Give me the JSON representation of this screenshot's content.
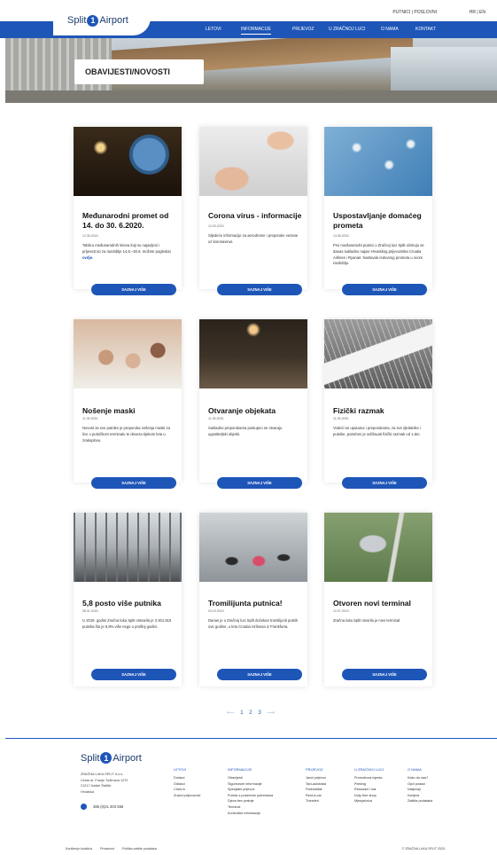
{
  "brand": {
    "name_left": "Split",
    "mark": "1",
    "name_right": "Airport"
  },
  "utility": {
    "left": "PUTNICI | POSLOVNI",
    "langs": "HR | EN"
  },
  "nav": {
    "items": [
      {
        "label": "LETOVI"
      },
      {
        "label": "INFORMACIJE",
        "active": true
      },
      {
        "label": "PRIJEVOZ"
      },
      {
        "label": "U ZRAČNOJ LUCI"
      },
      {
        "label": "O NAMA"
      },
      {
        "label": "KONTAKT"
      }
    ]
  },
  "hero": {
    "title": "OBAVIJESTI/NOVOSTI"
  },
  "cards": [
    {
      "title": "Međunarodni promet od 14. do 30. 6.2020.",
      "date": "12.06.2020.",
      "text": "Tablicu međunarodnih letova koji su najavljeni i prijevoznici za razdoblje 14.6.–30.6. možete pogledati ",
      "link": "ovdje.",
      "button": "SAZNAJ VIŠE",
      "img": "globe"
    },
    {
      "title": "Corona virus - informacije",
      "date": "12.03.2020.",
      "text": "Sljedeće informacije za aerodrome i preporuke vezane uz koronavirus.",
      "link": "",
      "button": "SAZNAJ VIŠE",
      "img": "hands"
    },
    {
      "title": "Uspostavljanje domaćeg prometa",
      "date": "13.05.2020.",
      "text": "Prvi međunarodni putnici u Zračnoj luci Split očekuju se danas sukladno najavi Hrvatskog prijevoznika Croatia Airlines i Ryanair. Nastavak redovnog prometa u ovom razdoblju.",
      "link": "",
      "button": "SAZNAJ VIŠE",
      "img": "virus"
    },
    {
      "title": "Nošenje maski",
      "date": "11.05.2020.",
      "text": "Novost za sve putnike je preporuka nošenja maski za lice u putničkom terminalu te obveza tijekom leta u zrakoplovu.",
      "link": "",
      "button": "SAZNAJ VIŠE",
      "img": "masks"
    },
    {
      "title": "Otvaranje objekata",
      "date": "11.05.2020.",
      "text": "Sukladno preporukama postupno se otvaraju ugostiteljski objekti.",
      "link": "",
      "button": "SAZNAJ VIŠE",
      "img": "restaurant"
    },
    {
      "title": "Fizički razmak",
      "date": "11.05.2020.",
      "text": "Vodeći se uputama i preporukama, za sve djelatnike i putnike, potrebno je održavati fizički razmak od 1,5m.",
      "link": "",
      "button": "SAZNAJ VIŠE",
      "img": "ruler"
    },
    {
      "title": "5,8 posto više putnika",
      "date": "08.01.2020.",
      "text": "U 2019. godini Zračna luka Split ostvarila je 3.301.815 putnika što je 5,8% više nego u prošloj godini.",
      "link": "",
      "button": "SAZNAJ VIŠE",
      "img": "terminal"
    },
    {
      "title": "Tromilijunta putnica!",
      "date": "03.10.2019.",
      "text": "Danas je u Zračnoj luci Split dočekan tromilijunti putnik ove godine, u letu Croatia Airlinesa iz Frankfurta.",
      "link": "",
      "button": "SAZNAJ VIŠE",
      "img": "people"
    },
    {
      "title": "Otvoren novi terminal",
      "date": "12.07.2019.",
      "text": "Zračna luka Split otvorila je novi terminal.",
      "link": "",
      "button": "SAZNAJ VIŠE",
      "img": "aerial"
    }
  ],
  "pager": {
    "prev": "⟵",
    "pages": [
      "1",
      "2",
      "3"
    ],
    "next": "⟶"
  },
  "footer": {
    "address": [
      "ZRAČNA LUKA SPLIT d.o.o.",
      "Cesta dr. Franje Tuđmana 1270",
      "21217 Kaštel Štafilić",
      "Hrvatska"
    ],
    "phone": "385 (0)21 203 555",
    "columns": [
      {
        "heading": "LETOVI",
        "items": [
          "Dolasci",
          "Odlasci",
          "Chek-in",
          "Zračni prijevoznici"
        ]
      },
      {
        "heading": "INFORMACIJE",
        "items": [
          "Obavijesti",
          "Sigurnosne informacije",
          "Specijalni prijevoz",
          "Putnici s posebnim potrebama",
          "Djeca bez pratnje",
          "Terminal",
          "Korisničke informacije"
        ]
      },
      {
        "heading": "PRIJEVOZ",
        "items": [
          "Javni prijevoz",
          "Taxi-autotaksi",
          "Parkiralište",
          "Rent-a-car",
          "Transferi"
        ]
      },
      {
        "heading": "U ZRAČNOJ LUCI",
        "items": [
          "Promotivna mjesta",
          "Parking",
          "Restorani i bar",
          "Duty free shop",
          "Mjenjačnica"
        ]
      },
      {
        "heading": "O NAMA",
        "items": [
          "Kako do nas?",
          "Opći podaci",
          "Natječaji",
          "Karijera",
          "Zaštita podataka"
        ]
      }
    ]
  },
  "legal": {
    "items": [
      "Korištenje kolačića",
      "Privatnost",
      "Politika zaštite podataka"
    ],
    "copy": "© ZRAČNA LUKA SPLIT 2020."
  },
  "colors": {
    "primary": "#1e56b8"
  }
}
